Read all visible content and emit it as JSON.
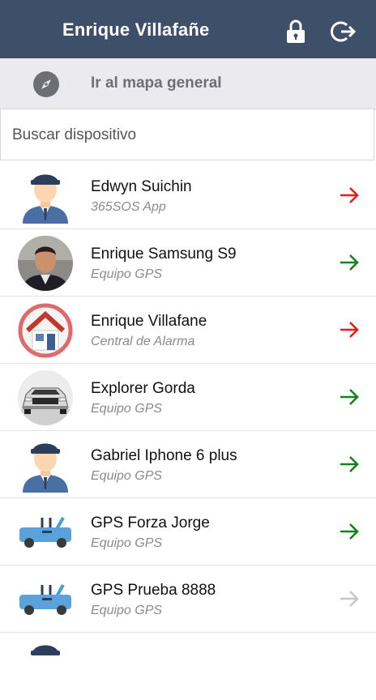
{
  "header": {
    "title": "Enrique Villafañe",
    "icons": [
      "lock-icon",
      "logout-icon"
    ]
  },
  "map_link": {
    "label": "Ir al mapa general",
    "icon": "compass-icon"
  },
  "search": {
    "placeholder": "Buscar dispositivo",
    "value": ""
  },
  "colors": {
    "header_bg": "#3e4f6a",
    "arrow_red": "#e3201b",
    "arrow_green": "#14831d",
    "arrow_gray": "#c8c8c8"
  },
  "devices": [
    {
      "name": "Edwyn Suichin",
      "type": "365SOS App",
      "avatar": "police-officer-icon",
      "arrow": "red"
    },
    {
      "name": "Enrique Samsung S9",
      "type": "Equipo GPS",
      "avatar": "person-photo",
      "arrow": "green"
    },
    {
      "name": "Enrique Villafane",
      "type": "Central de Alarma",
      "avatar": "house-icon",
      "arrow": "red"
    },
    {
      "name": "Explorer Gorda",
      "type": "Equipo GPS",
      "avatar": "suv-photo",
      "arrow": "green"
    },
    {
      "name": "Gabriel Iphone 6 plus",
      "type": "Equipo GPS",
      "avatar": "police-officer-icon",
      "arrow": "green"
    },
    {
      "name": "GPS Forza Jorge",
      "type": "Equipo GPS",
      "avatar": "convertible-car-icon",
      "arrow": "green"
    },
    {
      "name": "GPS Prueba 8888",
      "type": "Equipo GPS",
      "avatar": "convertible-car-icon",
      "arrow": "gray"
    }
  ]
}
